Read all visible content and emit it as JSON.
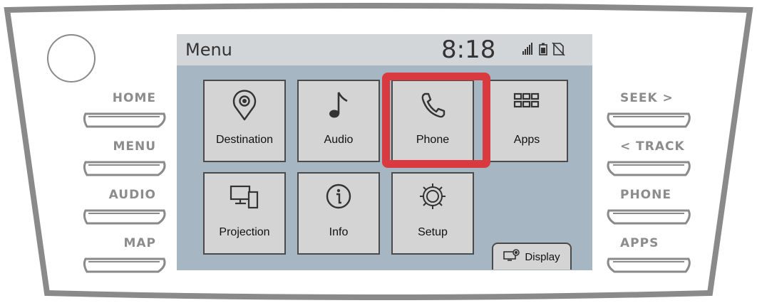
{
  "screen": {
    "title": "Menu",
    "clock": "8:18",
    "status_icons": [
      "signal-icon",
      "battery-icon",
      "no-sim-icon"
    ],
    "tiles": [
      {
        "label": "Destination",
        "icon": "location-pin-icon"
      },
      {
        "label": "Audio",
        "icon": "music-note-icon"
      },
      {
        "label": "Phone",
        "icon": "phone-handset-icon",
        "highlighted": true
      },
      {
        "label": "Apps",
        "icon": "app-grid-icon"
      },
      {
        "label": "Projection",
        "icon": "projection-devices-icon"
      },
      {
        "label": "Info",
        "icon": "info-icon"
      },
      {
        "label": "Setup",
        "icon": "gear-icon"
      }
    ],
    "display_button": {
      "label": "Display",
      "icon": "display-settings-icon"
    }
  },
  "hardware_buttons": {
    "left": [
      "HOME",
      "MENU",
      "AUDIO",
      "MAP"
    ],
    "right": [
      "SEEK >",
      "< TRACK",
      "PHONE",
      "APPS"
    ]
  },
  "colors": {
    "highlight": "#d93a3f",
    "screen_background": "#a6b6c2",
    "tile_background": "#d4d4d4",
    "hardware_label": "#8c8c8c"
  }
}
